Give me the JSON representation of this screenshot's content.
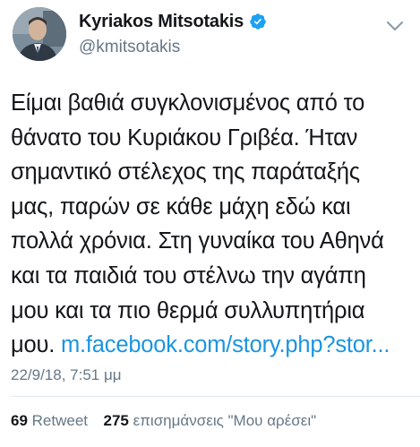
{
  "author": {
    "display_name": "Kyriakos Mitsotakis",
    "handle": "@kmitsotakis"
  },
  "tweet": {
    "lines": [
      "Είμαι βαθιά συγκλονισμένος από το",
      "θάνατο του Κυριάκου Γριβέα. Ήταν",
      "σημαντικό στέλεχος της παράταξής",
      "μας, παρών σε κάθε μάχη εδώ και",
      "πολλά χρόνια. Στη γυναίκα του Αθηνά",
      "και τα παιδιά του στέλνω την αγάπη",
      "μου και τα πιο θερμά συλλυπητήρια"
    ],
    "last_line_prefix": "μου. ",
    "link_text": "m.facebook.com/story.php?stor...",
    "timestamp": "22/9/18, 7:51 μμ"
  },
  "stats": {
    "retweets_count": "69",
    "retweets_label": "Retweet",
    "likes_count": "275",
    "likes_label": "επισημάνσεις \"Μου αρέσει\""
  },
  "icons": {
    "verified": "verified-badge-icon",
    "menu": "chevron-down-icon"
  },
  "colors": {
    "link": "#1b95e0",
    "verified": "#1da1f2",
    "secondary_text": "#657786",
    "primary_text": "#14171a"
  }
}
